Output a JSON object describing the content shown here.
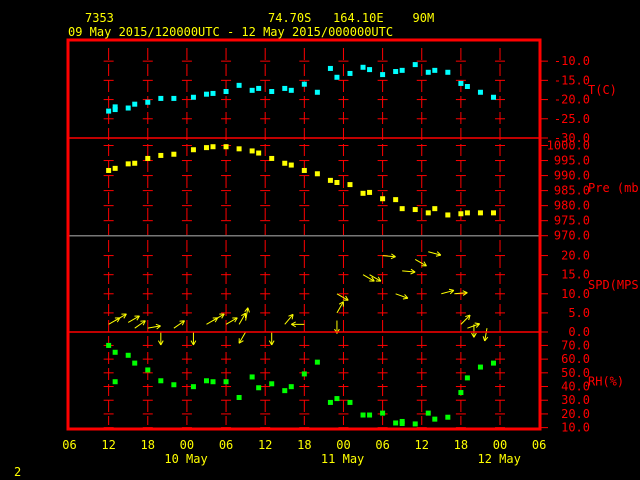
{
  "header": {
    "station": "7353",
    "location": "74.70S   164.10E    90M",
    "period": "09 May 2015/120000UTC - 12 May 2015/000000UTC"
  },
  "page_number": "2",
  "colors": {
    "frame": "#ff0000",
    "text": "#ffff00",
    "temp": "#00ffff",
    "pressure": "#ffff00",
    "wind": "#ffff00",
    "rh": "#00ff00"
  },
  "chart_data": {
    "type": "scatter",
    "x_unit": "hours since 09 May 06 UTC",
    "x_ticks": [
      {
        "h": 0,
        "label": "06"
      },
      {
        "h": 6,
        "label": "12"
      },
      {
        "h": 12,
        "label": "18"
      },
      {
        "h": 18,
        "label": "00"
      },
      {
        "h": 24,
        "label": "06"
      },
      {
        "h": 30,
        "label": "12"
      },
      {
        "h": 36,
        "label": "18"
      },
      {
        "h": 42,
        "label": "00"
      },
      {
        "h": 48,
        "label": "06"
      },
      {
        "h": 54,
        "label": "12"
      },
      {
        "h": 60,
        "label": "18"
      },
      {
        "h": 66,
        "label": "00"
      },
      {
        "h": 72,
        "label": "06"
      }
    ],
    "date_labels": [
      {
        "h": 24,
        "label": "10 May"
      },
      {
        "h": 48,
        "label": "11 May"
      },
      {
        "h": 72,
        "label": "12 May"
      }
    ],
    "xlim": [
      0,
      72
    ],
    "panels": [
      {
        "id": "temp",
        "label": "T(C)",
        "ylim": [
          -30,
          -4.5
        ],
        "ticks": [
          -10,
          -15,
          -20,
          -25,
          -30
        ],
        "tick_labels": [
          "-10.0",
          "-15.0",
          "-20.0",
          "-25.0",
          "-30.0"
        ],
        "points": [
          [
            6,
            -23.0
          ],
          [
            7,
            -21.9
          ],
          [
            7,
            -22.6
          ],
          [
            9,
            -22.2
          ],
          [
            10,
            -21.2
          ],
          [
            12,
            -20.7
          ],
          [
            14,
            -19.7
          ],
          [
            16,
            -19.7
          ],
          [
            19,
            -19.4
          ],
          [
            21,
            -18.6
          ],
          [
            22,
            -18.4
          ],
          [
            24,
            -17.9
          ],
          [
            26,
            -16.3
          ],
          [
            28,
            -17.6
          ],
          [
            29,
            -17.1
          ],
          [
            31,
            -17.9
          ],
          [
            33,
            -17.1
          ],
          [
            34,
            -17.6
          ],
          [
            36,
            -16.0
          ],
          [
            38,
            -18.1
          ],
          [
            40,
            -11.9
          ],
          [
            41,
            -14.2
          ],
          [
            43,
            -13.2
          ],
          [
            45,
            -11.6
          ],
          [
            46,
            -12.2
          ],
          [
            48,
            -13.5
          ],
          [
            50,
            -12.7
          ],
          [
            51,
            -12.4
          ],
          [
            53,
            -10.9
          ],
          [
            55,
            -12.9
          ],
          [
            56,
            -12.4
          ],
          [
            58,
            -12.9
          ],
          [
            60,
            -15.8
          ],
          [
            61,
            -16.6
          ],
          [
            63,
            -18.1
          ],
          [
            65,
            -19.4
          ]
        ]
      },
      {
        "id": "pressure",
        "label": "Pre (mb)",
        "ylim": [
          970,
          1002.5
        ],
        "ticks": [
          1000,
          995,
          990,
          985,
          980,
          975,
          970
        ],
        "tick_labels": [
          "1000.0",
          "995.0",
          "990.0",
          "985.0",
          "980.0",
          "975.0",
          "970.0"
        ],
        "points": [
          [
            6,
            991.7
          ],
          [
            7,
            992.4
          ],
          [
            9,
            993.9
          ],
          [
            10,
            994.1
          ],
          [
            12,
            995.7
          ],
          [
            14,
            996.7
          ],
          [
            16,
            997.1
          ],
          [
            19,
            998.6
          ],
          [
            21,
            999.3
          ],
          [
            22,
            999.6
          ],
          [
            24,
            999.6
          ],
          [
            26,
            998.9
          ],
          [
            28,
            998.2
          ],
          [
            29,
            997.5
          ],
          [
            31,
            995.7
          ],
          [
            33,
            994.1
          ],
          [
            34,
            993.5
          ],
          [
            36,
            991.7
          ],
          [
            38,
            990.6
          ],
          [
            40,
            988.4
          ],
          [
            41,
            987.7
          ],
          [
            43,
            987.0
          ],
          [
            45,
            984.1
          ],
          [
            46,
            984.4
          ],
          [
            48,
            982.3
          ],
          [
            50,
            982.0
          ],
          [
            51,
            979.0
          ],
          [
            53,
            978.7
          ],
          [
            55,
            977.6
          ],
          [
            56,
            979.0
          ],
          [
            58,
            976.9
          ],
          [
            60,
            977.3
          ],
          [
            61,
            977.6
          ],
          [
            63,
            977.6
          ],
          [
            65,
            977.6
          ]
        ]
      },
      {
        "id": "wind",
        "label": "SPD(MPS)",
        "ylim": [
          0,
          25.2
        ],
        "ticks": [
          20,
          15,
          10,
          5,
          0
        ],
        "tick_labels": [
          "20.0",
          "15.0",
          "10.0",
          "5.0",
          "0.0"
        ],
        "arrows_hour_speed_todir": [
          [
            6,
            2,
            60
          ],
          [
            7,
            3,
            60
          ],
          [
            9,
            2.5,
            60
          ],
          [
            10,
            1,
            55
          ],
          [
            12,
            1,
            80
          ],
          [
            14,
            0,
            180
          ],
          [
            16,
            1,
            55
          ],
          [
            19,
            0,
            180
          ],
          [
            21,
            2,
            60
          ],
          [
            22,
            3,
            60
          ],
          [
            24,
            2,
            60
          ],
          [
            26,
            2,
            30
          ],
          [
            27,
            3,
            10
          ],
          [
            27,
            0,
            210
          ],
          [
            31,
            0,
            180
          ],
          [
            33,
            2,
            40
          ],
          [
            36,
            2,
            270
          ],
          [
            41,
            10,
            120
          ],
          [
            41,
            3,
            180
          ],
          [
            41,
            5,
            30
          ],
          [
            45,
            15,
            120
          ],
          [
            46,
            15,
            120
          ],
          [
            48,
            20,
            95
          ],
          [
            50,
            10,
            110
          ],
          [
            51,
            16,
            95
          ],
          [
            53,
            19,
            120
          ],
          [
            55,
            21,
            105
          ],
          [
            57,
            10,
            75
          ],
          [
            59,
            10,
            85
          ],
          [
            60,
            2,
            45
          ],
          [
            61,
            1,
            70
          ],
          [
            62,
            2,
            180
          ],
          [
            64,
            1,
            190
          ]
        ]
      },
      {
        "id": "rh",
        "label": "RH(%)",
        "ylim": [
          9,
          79.8
        ],
        "ticks": [
          70,
          60,
          50,
          40,
          30,
          20,
          10
        ],
        "tick_labels": [
          "70.0",
          "60.0",
          "50.0",
          "40.0",
          "30.0",
          "20.0",
          "10.0"
        ],
        "points": [
          [
            6,
            70
          ],
          [
            7,
            65
          ],
          [
            7,
            43.5
          ],
          [
            9,
            62.8
          ],
          [
            10,
            57.1
          ],
          [
            12,
            52.1
          ],
          [
            14,
            44.2
          ],
          [
            16,
            41.3
          ],
          [
            19,
            39.9
          ],
          [
            21,
            44.2
          ],
          [
            22,
            43.5
          ],
          [
            24,
            43.5
          ],
          [
            26,
            32.0
          ],
          [
            28,
            47.0
          ],
          [
            29,
            39.1
          ],
          [
            31,
            42.0
          ],
          [
            33,
            37.0
          ],
          [
            34,
            39.9
          ],
          [
            36,
            49.2
          ],
          [
            38,
            57.8
          ],
          [
            40,
            28.4
          ],
          [
            41,
            31.2
          ],
          [
            43,
            28.4
          ],
          [
            45,
            19.2
          ],
          [
            46,
            19.2
          ],
          [
            48,
            20.6
          ],
          [
            50,
            13.4
          ],
          [
            51,
            14.5
          ],
          [
            51,
            13.0
          ],
          [
            53,
            12.7
          ],
          [
            55,
            20.6
          ],
          [
            56,
            16.2
          ],
          [
            58,
            17.6
          ],
          [
            60,
            35.6
          ],
          [
            61,
            46.3
          ],
          [
            63,
            54.2
          ],
          [
            65,
            57.1
          ]
        ]
      }
    ]
  }
}
